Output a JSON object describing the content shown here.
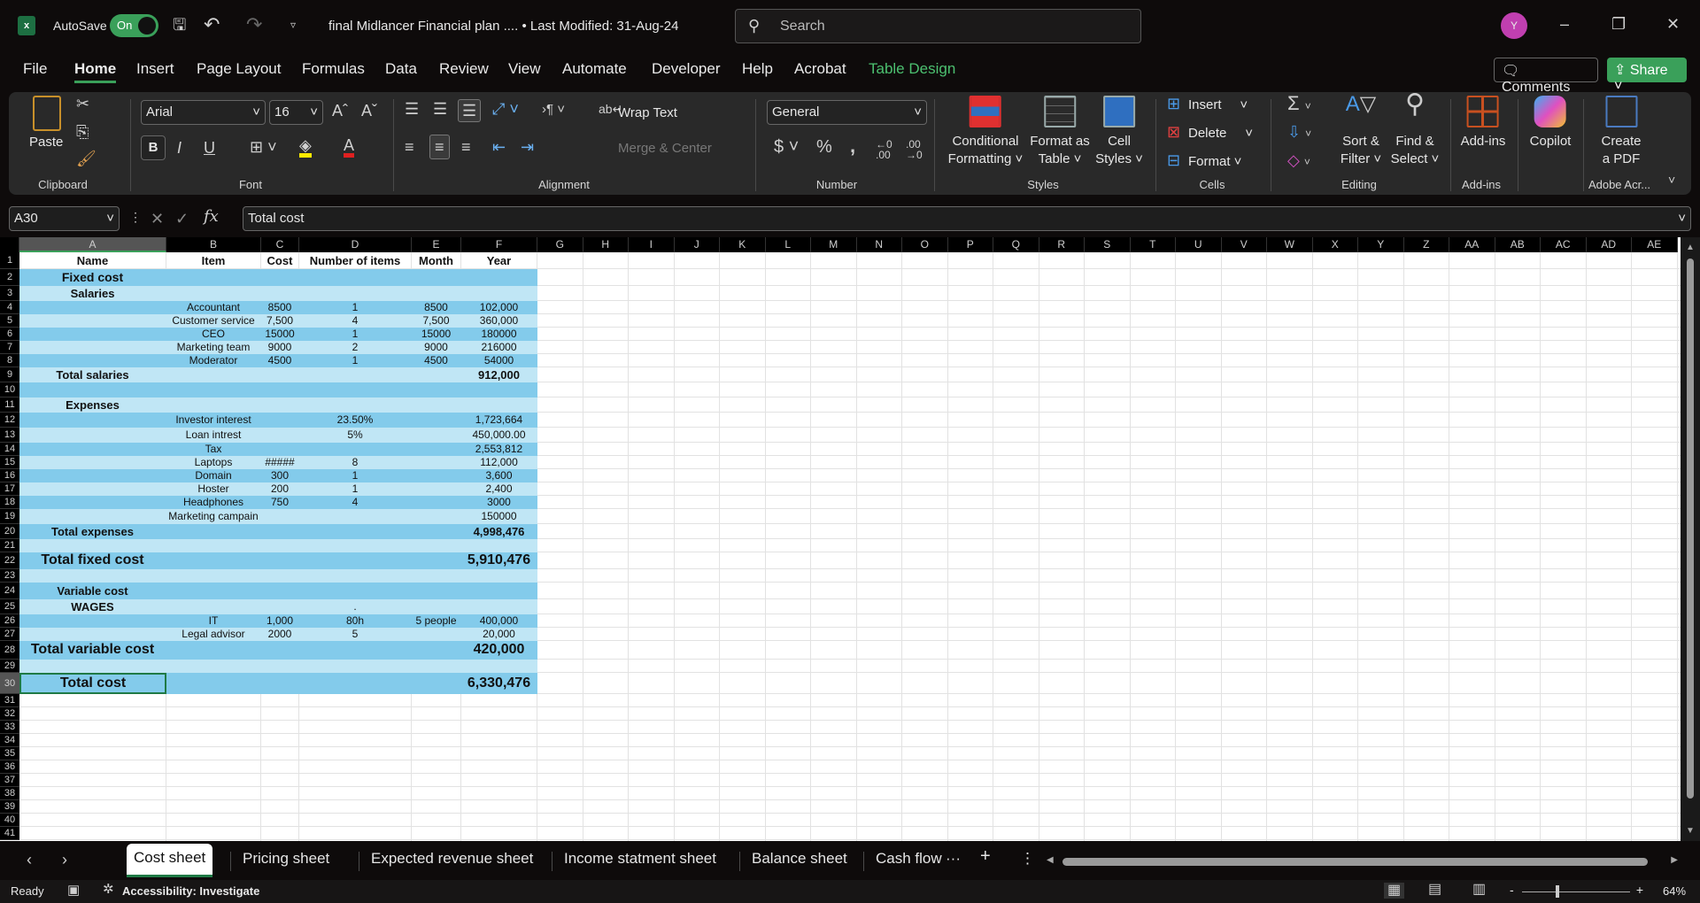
{
  "titlebar": {
    "autosave_label": "AutoSave",
    "autosave_state": "On",
    "title": "final Midlancer Financial plan ....  •  Last Modified: 31-Aug-24",
    "search_placeholder": "Search",
    "avatar_initial": "Y"
  },
  "menu": {
    "tabs": [
      "File",
      "Home",
      "Insert",
      "Page Layout",
      "Formulas",
      "Data",
      "Review",
      "View",
      "Automate",
      "Developer",
      "Help",
      "Acrobat",
      "Table Design"
    ],
    "active": "Home",
    "comments": "Comments",
    "share": "Share"
  },
  "ribbon": {
    "clipboard": {
      "paste": "Paste",
      "label": "Clipboard"
    },
    "font": {
      "name": "Arial",
      "size": "16",
      "label": "Font",
      "bold": "B",
      "italic": "I",
      "underline": "U",
      "fill_color": "#ffea00",
      "font_color": "#e02020"
    },
    "alignment": {
      "wrap": "Wrap Text",
      "merge": "Merge & Center",
      "label": "Alignment"
    },
    "number": {
      "format": "General",
      "label": "Number"
    },
    "styles": {
      "conditional": [
        "Conditional",
        "Formatting"
      ],
      "format_table": [
        "Format as",
        "Table"
      ],
      "cell_styles": [
        "Cell",
        "Styles"
      ],
      "label": "Styles"
    },
    "cells": {
      "insert": "Insert",
      "delete": "Delete",
      "format": "Format",
      "label": "Cells"
    },
    "editing": {
      "sort": [
        "Sort &",
        "Filter"
      ],
      "find": [
        "Find &",
        "Select"
      ],
      "label": "Editing"
    },
    "addins": {
      "button": "Add-ins",
      "label": "Add-ins"
    },
    "copilot": {
      "button": "Copilot"
    },
    "adobe": {
      "button": [
        "Create",
        "a PDF"
      ],
      "label": "Adobe Acr..."
    }
  },
  "formula_bar": {
    "name_box": "A30",
    "formula": "Total cost"
  },
  "sheet": {
    "columns": [
      "A",
      "B",
      "C",
      "D",
      "E",
      "F",
      "G",
      "H",
      "I",
      "J",
      "K",
      "L",
      "M",
      "N",
      "O",
      "P",
      "Q",
      "R",
      "S",
      "T",
      "U",
      "V",
      "W",
      "X",
      "Y",
      "Z",
      "AA",
      "AB",
      "AC",
      "AD",
      "AE"
    ],
    "fill_dark": "#83cbeb",
    "fill_light": "#c0e6f5",
    "rows": [
      {
        "A": "Name",
        "B": "Item",
        "C": "Cost",
        "D": "Number of items",
        "E": "Month",
        "F": "Year"
      },
      {
        "A": "Fixed cost"
      },
      {
        "A": "Salaries"
      },
      {
        "B": "Accountant",
        "C": "8500",
        "D": "1",
        "E": "8500",
        "F": "102,000"
      },
      {
        "B": "Customer service",
        "C": "7,500",
        "D": "4",
        "E": "7,500",
        "F": "360,000"
      },
      {
        "B": "CEO",
        "C": "15000",
        "D": "1",
        "E": "15000",
        "F": "180000"
      },
      {
        "B": "Marketing team",
        "C": "9000",
        "D": "2",
        "E": "9000",
        "F": "216000"
      },
      {
        "B": "Moderator",
        "C": "4500",
        "D": "1",
        "E": "4500",
        "F": "54000"
      },
      {
        "A": "Total salaries",
        "F": "912,000"
      },
      {},
      {
        "A": "Expenses"
      },
      {
        "B": "Investor interest",
        "D": "23.50%",
        "F": "1,723,664"
      },
      {
        "B": "Loan intrest",
        "D": "5%",
        "F": "450,000.00"
      },
      {
        "B": "Tax",
        "F": "2,553,812"
      },
      {
        "B": "Laptops",
        "C": "#####",
        "D": "8",
        "F": "112,000"
      },
      {
        "B": "Domain",
        "C": "300",
        "D": "1",
        "F": "3,600"
      },
      {
        "B": "Hoster",
        "C": "200",
        "D": "1",
        "F": "2,400"
      },
      {
        "B": "Headphones",
        "C": "750",
        "D": "4",
        "F": "3000"
      },
      {
        "B": "Marketing campain",
        "F": "150000"
      },
      {
        "A": "Total expenses",
        "F": "4,998,476"
      },
      {},
      {
        "A": "Total fixed cost",
        "F": "5,910,476"
      },
      {},
      {
        "A": "Variable cost"
      },
      {
        "A": "WAGES",
        "D": "."
      },
      {
        "B": "IT",
        "C": "1,000",
        "D": "80h",
        "E": "5 people",
        "F": "400,000"
      },
      {
        "B": "Legal advisor",
        "C": "2000",
        "D": "5",
        "F": "20,000"
      },
      {
        "A": "Total variable cost",
        "F": "420,000"
      },
      {},
      {
        "A": "Total cost",
        "F": "6,330,476"
      }
    ],
    "row_count": 41,
    "selected_cell": "A30"
  },
  "sheet_tabs": {
    "tabs": [
      "Cost sheet",
      "Pricing sheet",
      "Expected revenue sheet",
      "Income statment sheet",
      "Balance sheet",
      "Cash flow"
    ],
    "active": "Cost sheet",
    "more": "···",
    "add": "+"
  },
  "status": {
    "ready": "Ready",
    "accessibility": "Accessibility: Investigate",
    "zoom": "64%"
  }
}
